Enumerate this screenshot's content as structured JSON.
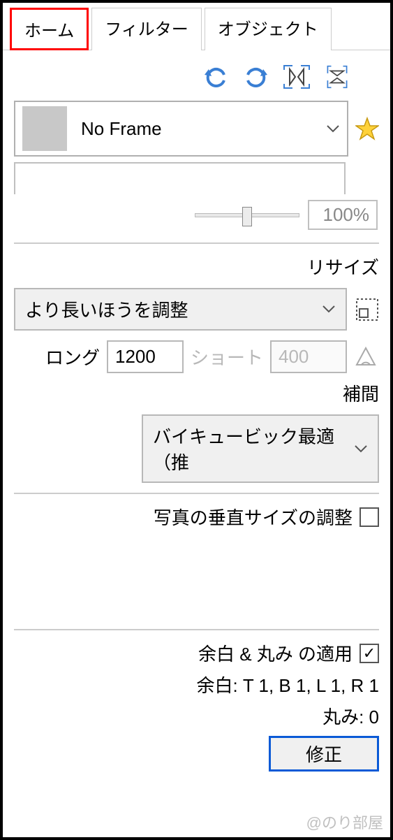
{
  "tabs": {
    "home": "ホーム",
    "filter": "フィルター",
    "object": "オブジェクト"
  },
  "frame": {
    "label": "No Frame"
  },
  "opacity": {
    "value": "100%"
  },
  "resize": {
    "title": "リサイズ",
    "mode": "より長いほうを調整",
    "long_label": "ロング",
    "long_value": "1200",
    "short_label": "ショート",
    "short_value": "400",
    "interp_title": "補間",
    "interp_value": "バイキュービック最適（推"
  },
  "vertical": {
    "label": "写真の垂直サイズの調整"
  },
  "margin": {
    "apply_label": "余白 & 丸み の適用",
    "values_label": "余白: T 1, B 1, L 1, R 1",
    "round_label": "丸み: 0",
    "modify": "修正"
  },
  "watermark": "@のり部屋"
}
